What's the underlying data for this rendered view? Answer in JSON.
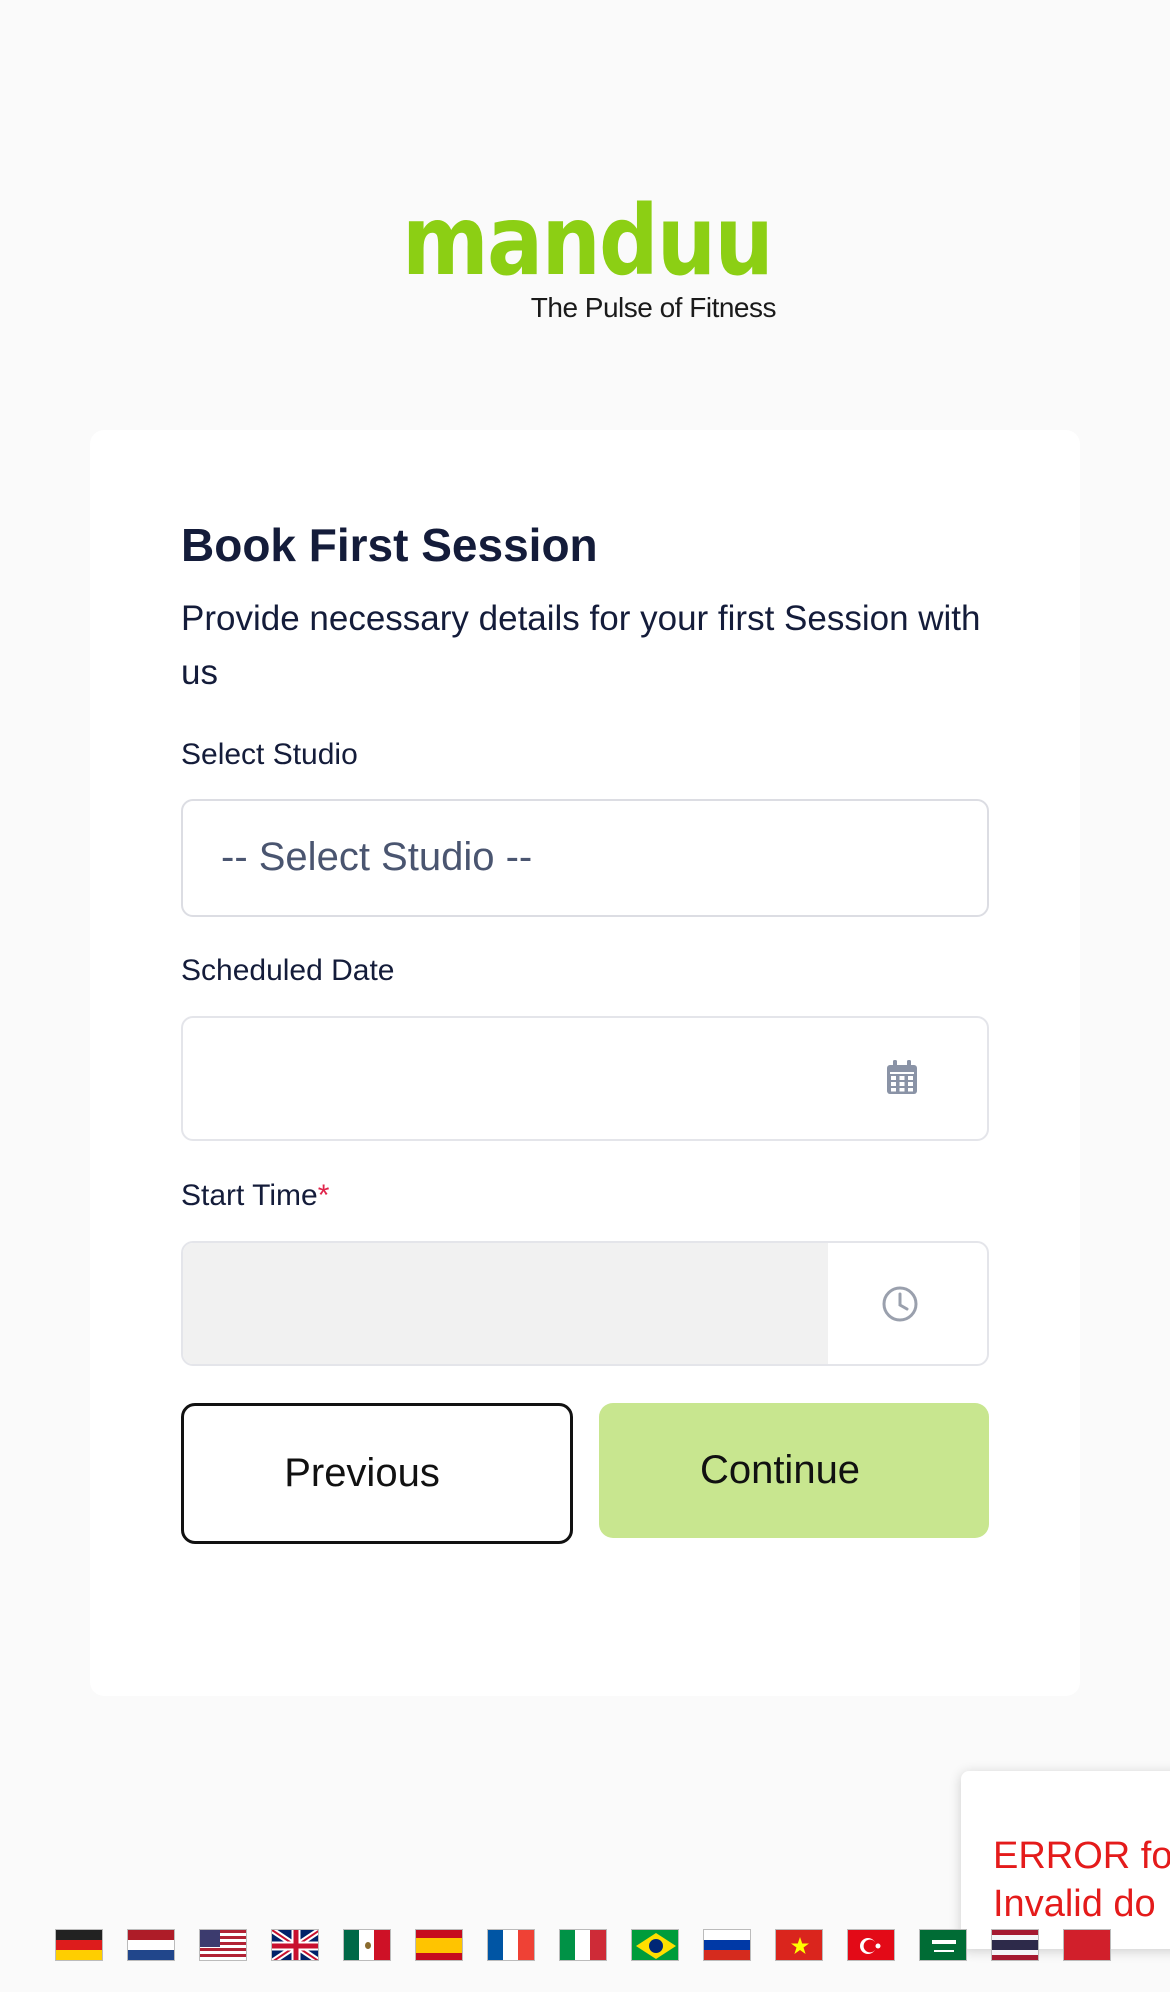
{
  "brand": {
    "logo_text": "manduu",
    "tagline": "The Pulse of Fitness",
    "color": "#8ccf14"
  },
  "form": {
    "title": "Book First Session",
    "subtitle": "Provide necessary details for your first Session with us",
    "studio": {
      "label": "Select Studio",
      "selected": "-- Select Studio --"
    },
    "date": {
      "label": "Scheduled Date",
      "value": "",
      "icon": "calendar-icon"
    },
    "time": {
      "label": "Start Time",
      "required_mark": "*",
      "value": "",
      "icon": "clock-icon"
    },
    "previous_label": "Previous",
    "continue_label": "Continue"
  },
  "toast": {
    "line1": "ERROR fo",
    "line2": "Invalid do"
  },
  "languages": [
    "German",
    "Dutch",
    "English (US)",
    "English (UK)",
    "Spanish (Mexico)",
    "Spanish",
    "French",
    "Italian",
    "Portuguese (Brazil)",
    "Russian",
    "Vietnamese",
    "Turkish",
    "Arabic",
    "Thai",
    "Other"
  ],
  "colors": {
    "background": "#fafafa",
    "card": "#ffffff",
    "text": "#141c3a",
    "continue_button": "#c8e68f",
    "required": "#e0254b",
    "error": "#e41b1b"
  }
}
